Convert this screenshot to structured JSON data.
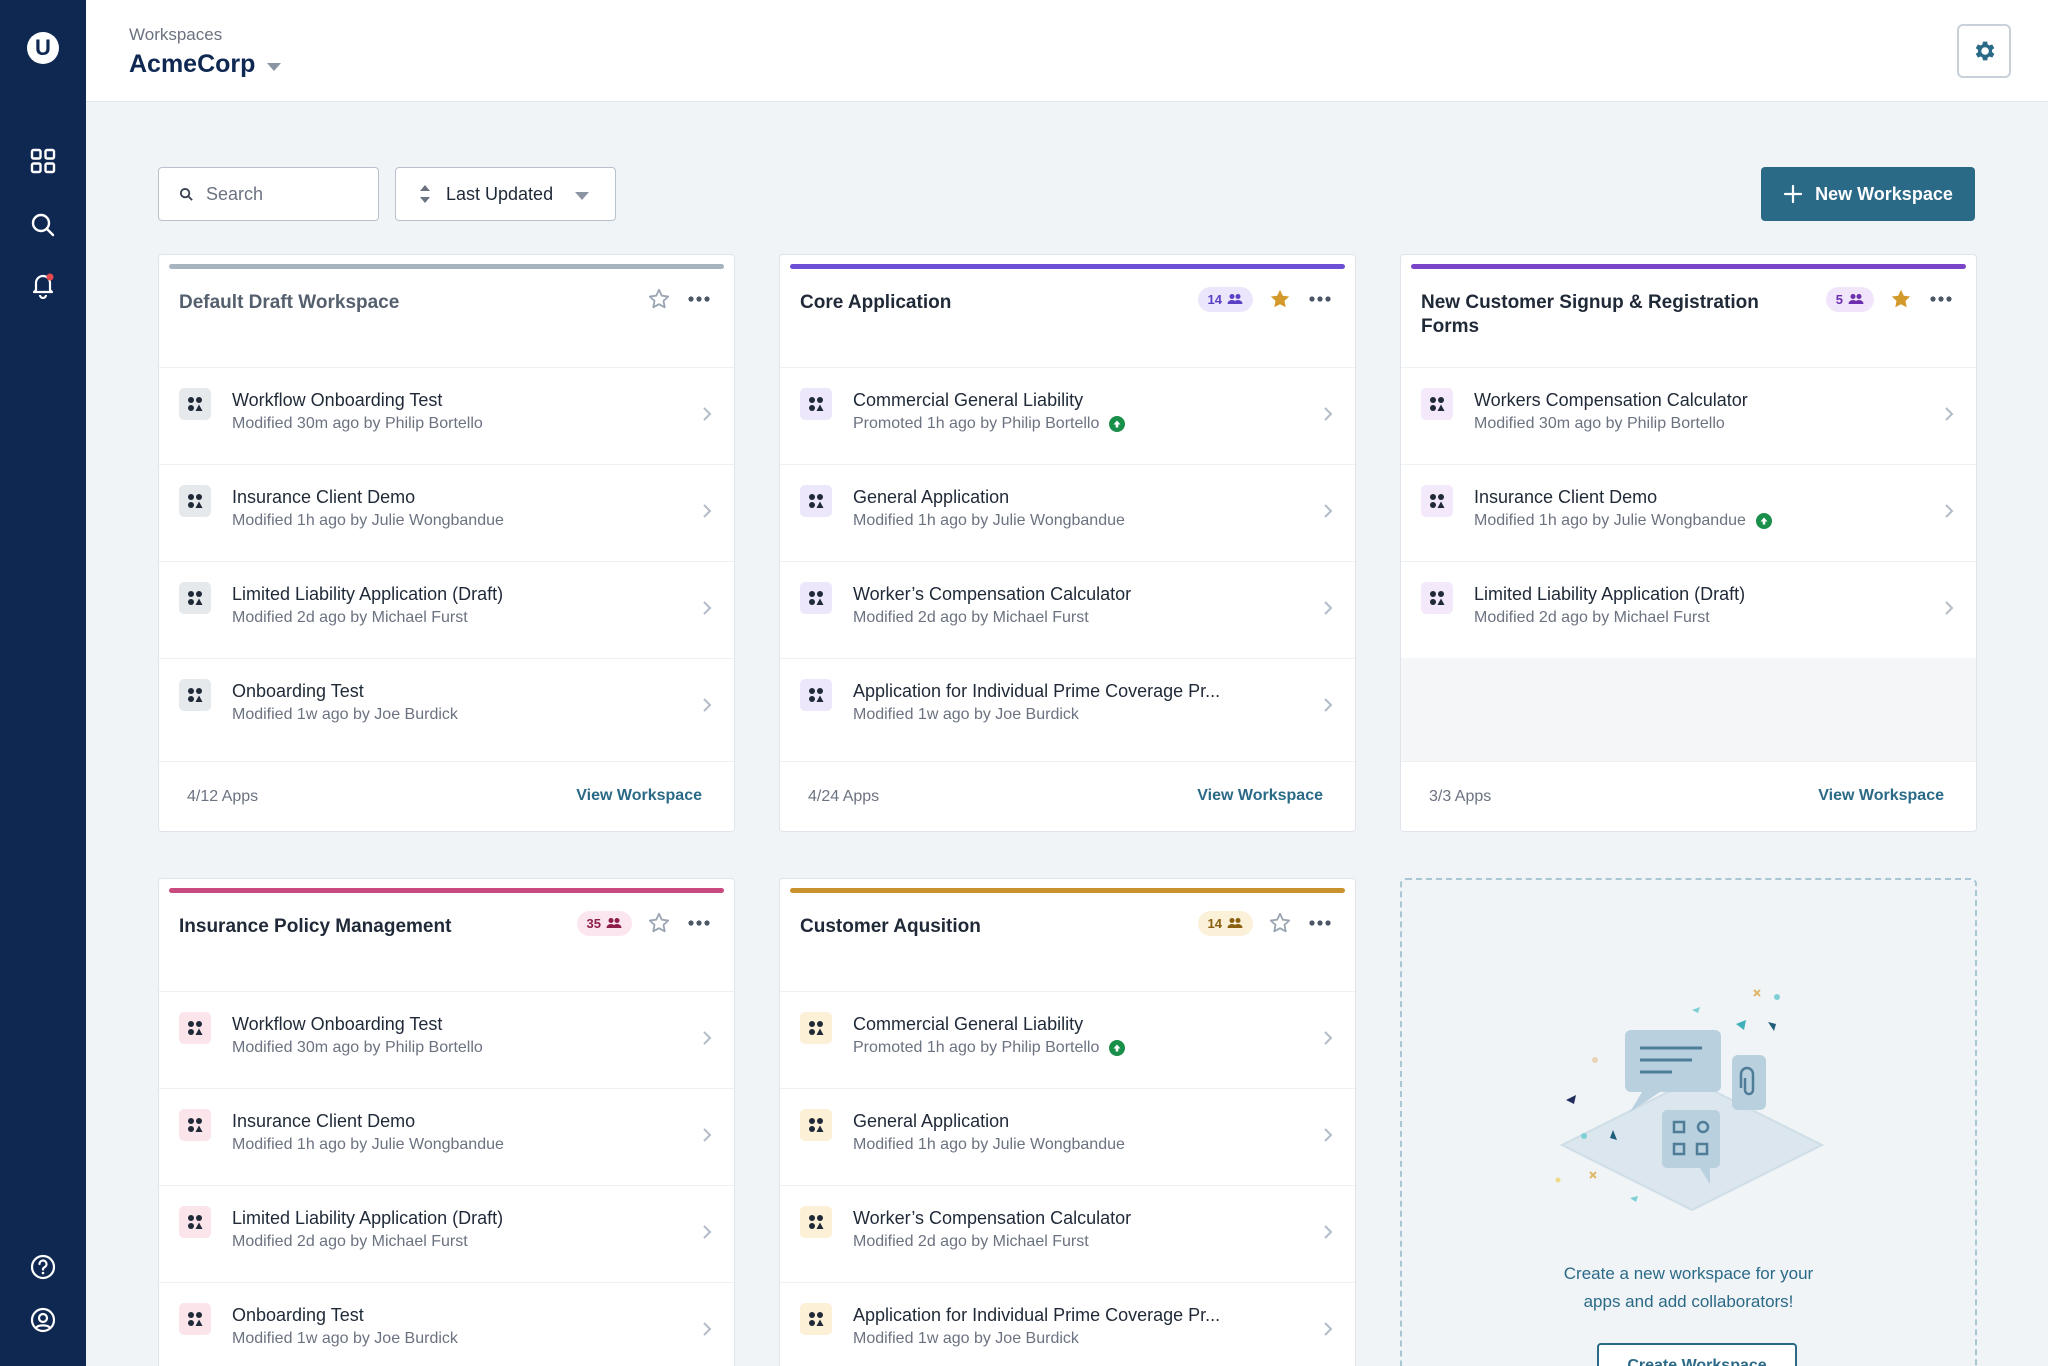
{
  "header": {
    "breadcrumb": "Workspaces",
    "workspace_name": "AcmeCorp"
  },
  "sidebar": {
    "logo_letter": "U",
    "items": [
      {
        "icon": "grid-icon"
      },
      {
        "icon": "search-icon"
      },
      {
        "icon": "bell-icon"
      },
      {
        "icon": "help-icon"
      },
      {
        "icon": "user-icon"
      }
    ]
  },
  "toolbar": {
    "search_placeholder": "Search",
    "sort_label": "Last Updated",
    "new_workspace_label": "New Workspace"
  },
  "colors": {
    "sidebar": "#0f2852",
    "accent": "#2b6a87",
    "grey": "#a7b4bf",
    "purple": "#6d4ed6",
    "violet": "#7b45c9",
    "pink": "#c94a7e",
    "gold": "#c9922c"
  },
  "cards": [
    {
      "title": "Default Draft Workspace",
      "members": "",
      "starred": false,
      "apps": [
        {
          "name": "Workflow Onboarding Test",
          "meta": "Modified 30m ago by Philip Bortello",
          "promoted": false
        },
        {
          "name": "Insurance Client Demo",
          "meta": "Modified 1h ago by Julie Wongbandue",
          "promoted": false
        },
        {
          "name": "Limited Liability Application (Draft)",
          "meta": "Modified 2d ago by Michael Furst",
          "promoted": false
        },
        {
          "name": "Onboarding Test",
          "meta": "Modified 1w ago by Joe Burdick",
          "promoted": false
        }
      ],
      "count": "4/12 Apps",
      "view_label": "View Workspace"
    },
    {
      "title": "Core Application",
      "members": "14",
      "starred": true,
      "apps": [
        {
          "name": "Commercial General Liability",
          "meta": "Promoted 1h ago by Philip Bortello",
          "promoted": true
        },
        {
          "name": "General Application",
          "meta": "Modified 1h ago by Julie Wongbandue",
          "promoted": false
        },
        {
          "name": "Worker’s Compensation Calculator",
          "meta": "Modified 2d ago by Michael Furst",
          "promoted": false
        },
        {
          "name": "Application for Individual Prime Coverage Pr...",
          "meta": "Modified 1w ago by Joe Burdick",
          "promoted": false
        }
      ],
      "count": "4/24 Apps",
      "view_label": "View Workspace"
    },
    {
      "title": "New Customer Signup & Registration Forms",
      "members": "5",
      "starred": true,
      "apps": [
        {
          "name": "Workers Compensation Calculator",
          "meta": "Modified 30m ago by Philip Bortello",
          "promoted": false
        },
        {
          "name": "Insurance Client Demo",
          "meta": "Modified 1h ago by Julie Wongbandue",
          "promoted": true
        },
        {
          "name": "Limited Liability Application (Draft)",
          "meta": "Modified 2d ago by Michael Furst",
          "promoted": false
        }
      ],
      "count": "3/3 Apps",
      "view_label": "View Workspace"
    },
    {
      "title": "Insurance Policy Management",
      "members": "35",
      "starred": false,
      "apps": [
        {
          "name": "Workflow Onboarding Test",
          "meta": "Modified 30m ago by Philip Bortello",
          "promoted": false
        },
        {
          "name": "Insurance Client Demo",
          "meta": "Modified 1h ago by Julie Wongbandue",
          "promoted": false
        },
        {
          "name": "Limited Liability Application (Draft)",
          "meta": "Modified 2d ago by Michael Furst",
          "promoted": false
        },
        {
          "name": "Onboarding Test",
          "meta": "Modified 1w ago by Joe Burdick",
          "promoted": false
        }
      ]
    },
    {
      "title": "Customer Aqusition",
      "members": "14",
      "starred": false,
      "apps": [
        {
          "name": "Commercial General Liability",
          "meta": "Promoted 1h ago by Philip Bortello",
          "promoted": true
        },
        {
          "name": "General Application",
          "meta": "Modified 1h ago by Julie Wongbandue",
          "promoted": false
        },
        {
          "name": "Worker’s Compensation Calculator",
          "meta": "Modified 2d ago by Michael Furst",
          "promoted": false
        },
        {
          "name": "Application for Individual Prime Coverage Pr...",
          "meta": "Modified 1w ago by Joe Burdick",
          "promoted": false
        }
      ]
    }
  ],
  "create_card": {
    "text_line1": "Create a new workspace for your",
    "text_line2": "apps and add collaborators!",
    "button_label": "Create Workspace"
  }
}
